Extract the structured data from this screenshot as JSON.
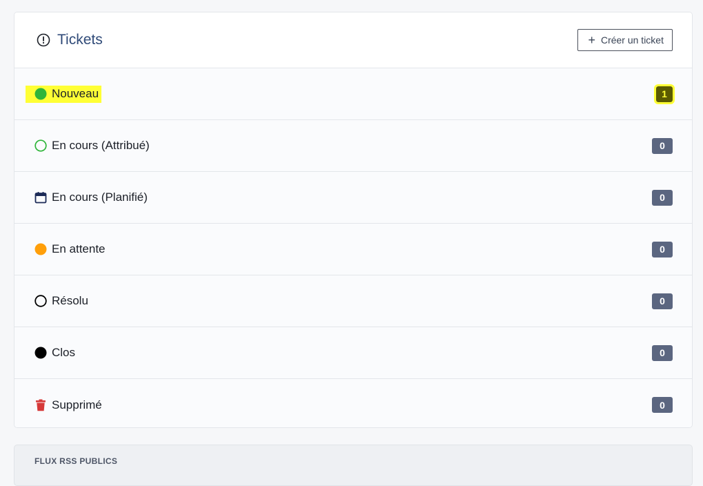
{
  "header": {
    "title": "Tickets",
    "create_label": "Créer un ticket"
  },
  "rows": [
    {
      "label": "Nouveau",
      "count": "1",
      "icon": "green-dot-icon",
      "color": "#2fb53a"
    },
    {
      "label": "En cours (Attribué)",
      "count": "0",
      "icon": "green-circle-outline-icon",
      "color": "#2fb53a"
    },
    {
      "label": "En cours (Planifié)",
      "count": "0",
      "icon": "calendar-icon",
      "color": "#1b2a57"
    },
    {
      "label": "En attente",
      "count": "0",
      "icon": "orange-dot-icon",
      "color": "#ff9f0a"
    },
    {
      "label": "Résolu",
      "count": "0",
      "icon": "black-circle-outline-icon",
      "color": "#000000"
    },
    {
      "label": "Clos",
      "count": "0",
      "icon": "black-dot-icon",
      "color": "#000000"
    },
    {
      "label": "Supprimé",
      "count": "0",
      "icon": "trash-icon",
      "color": "#d63939"
    }
  ],
  "rss": {
    "title": "FLUX RSS PUBLICS"
  },
  "colors": {
    "title": "#2f4a78",
    "badge": "#5b6680",
    "highlight": "#ffff35"
  }
}
